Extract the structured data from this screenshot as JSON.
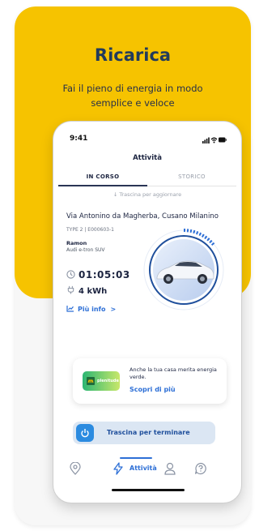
{
  "hero": {
    "title": "Ricarica",
    "subtitle": "Fai il pieno di energia in modo semplice e veloce"
  },
  "status_bar": {
    "time": "9:41"
  },
  "app": {
    "title": "Attività",
    "tabs": [
      {
        "label": "IN CORSO",
        "active": true
      },
      {
        "label": "STORICO",
        "active": false
      }
    ],
    "pull_hint": "Trascina per aggiornare"
  },
  "session": {
    "address": "Via Antonino da Magherba, Cusano Milanino",
    "connector": "TYPE 2 | E000603-1",
    "owner": "Ramon",
    "car_model": "Audi e-tron SUV",
    "elapsed": "01:05:03",
    "energy": "4 kWh",
    "info_link": "Più info",
    "info_chevron": ">"
  },
  "promo": {
    "logo_text": "plenitude",
    "text": "Anche la tua casa merita energia verde.",
    "link": "Scopri di più"
  },
  "slider": {
    "label": "Trascina per terminare"
  },
  "nav": {
    "items": [
      {
        "icon": "map-pin-icon"
      },
      {
        "icon": "lightning-icon",
        "label": "Attività",
        "active": true
      },
      {
        "icon": "user-icon"
      },
      {
        "icon": "help-icon"
      }
    ]
  },
  "colors": {
    "accent_yellow": "#f6c300",
    "primary_blue": "#2d6fd6",
    "dark_navy": "#1c2440"
  }
}
